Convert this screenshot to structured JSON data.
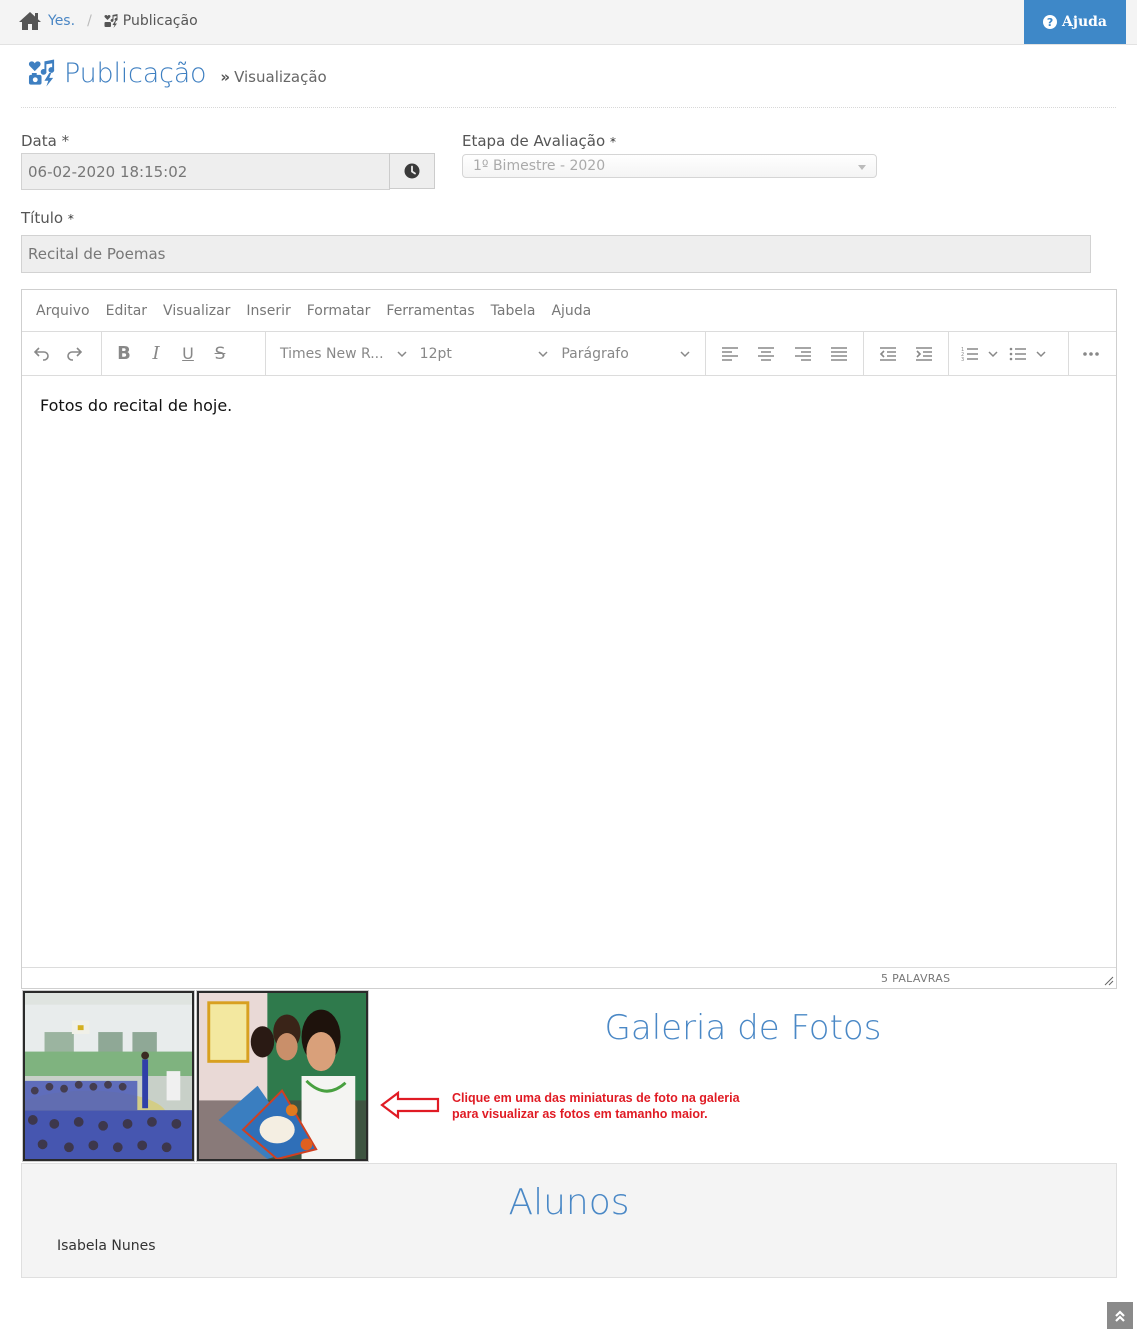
{
  "breadcrumb": {
    "home_icon": "home-icon",
    "root_label": "Yes.",
    "separator": "/",
    "current_icon": "publication-icon",
    "current_label": "Publicação"
  },
  "help_button": {
    "icon": "question-circle-icon",
    "label": "Ajuda"
  },
  "page": {
    "title": "Publicação",
    "subtitle_icon": "double-chevron-right-icon",
    "subtitle": "Visualização"
  },
  "form": {
    "date": {
      "label": "Data",
      "required_mark": "*",
      "value": "06-02-2020 18:15:02",
      "addon_icon": "clock-icon"
    },
    "stage": {
      "label": "Etapa de Avaliação",
      "required_mark": "*",
      "selected": "1º Bimestre - 2020"
    },
    "title": {
      "label": "Título",
      "required_mark": "*",
      "value": "Recital de Poemas"
    }
  },
  "editor": {
    "menu": [
      "Arquivo",
      "Editar",
      "Visualizar",
      "Inserir",
      "Formatar",
      "Ferramentas",
      "Tabela",
      "Ajuda"
    ],
    "toolbar": {
      "font_family": "Times New R...",
      "font_size": "12pt",
      "block_format": "Parágrafo"
    },
    "content": "Fotos do recital de hoje.",
    "word_count": "5 PALAVRAS"
  },
  "gallery": {
    "title": "Galeria de Fotos",
    "photos": [
      {
        "alt": "Alunos sentados na quadra assistindo ao recital"
      },
      {
        "alt": "Alunos lendo poemas com livros nas mãos"
      }
    ],
    "hint_line1": "Clique em uma das miniaturas de foto na galeria",
    "hint_line2": "para visualizar as fotos em tamanho maior.",
    "hint_color": "#e01b24"
  },
  "students": {
    "title": "Alunos",
    "items": [
      "Isabela Nunes"
    ]
  },
  "colors": {
    "accent": "#3e88c8",
    "title_blue": "#4a88c6"
  }
}
